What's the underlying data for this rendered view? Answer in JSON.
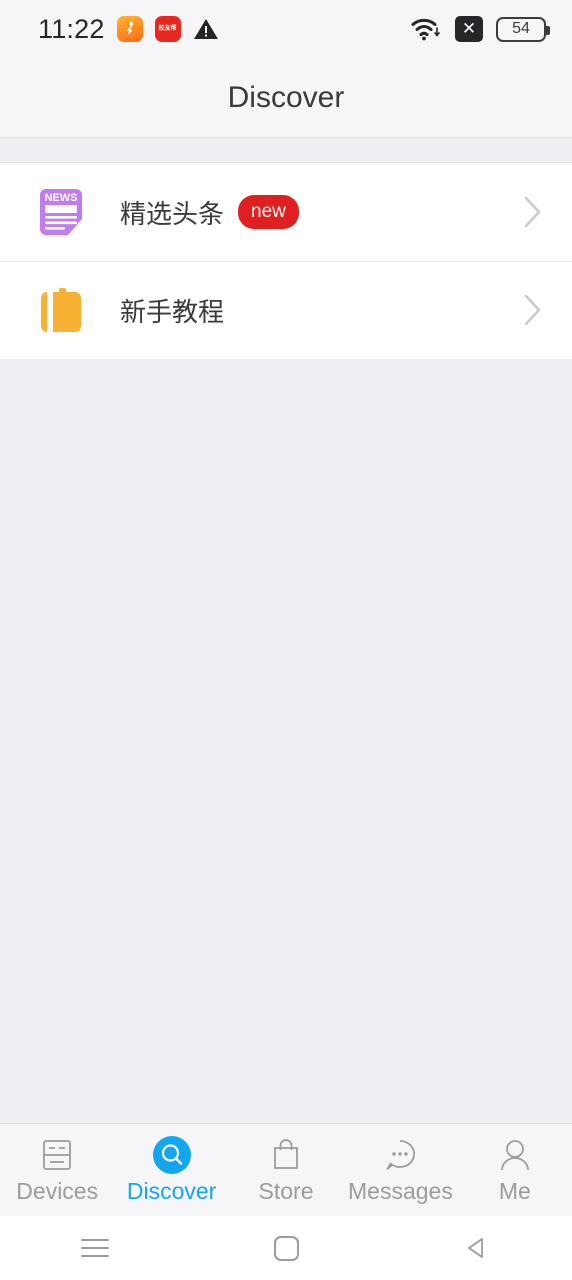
{
  "status_bar": {
    "time": "11:22",
    "notif_icons": [
      {
        "name": "runner-app-icon",
        "label": ""
      },
      {
        "name": "red-app-icon",
        "label": "校友帮"
      },
      {
        "name": "warning-triangle-icon",
        "label": ""
      }
    ],
    "wifi_icon": "wifi-icon",
    "sim_icon": "no-sim-icon",
    "battery_level": "54"
  },
  "header": {
    "title": "Discover"
  },
  "list": {
    "items": [
      {
        "icon": "news-icon",
        "label": "精选头条",
        "badge": "new",
        "chevron": "chevron-right-icon"
      },
      {
        "icon": "tutorial-book-icon",
        "label": "新手教程",
        "badge": "",
        "chevron": "chevron-right-icon"
      }
    ]
  },
  "tab_bar": {
    "active_index": 1,
    "active_color": "#13a6ef",
    "inactive_color": "#9b9ba1",
    "tabs": [
      {
        "label": "Devices",
        "icon": "devices-icon"
      },
      {
        "label": "Discover",
        "icon": "search-circle-icon"
      },
      {
        "label": "Store",
        "icon": "shopping-bag-icon"
      },
      {
        "label": "Messages",
        "icon": "chat-bubble-icon"
      },
      {
        "label": "Me",
        "icon": "person-icon"
      }
    ]
  },
  "nav_bar": {
    "recents": "recents-icon",
    "home": "home-icon",
    "back": "back-icon"
  }
}
